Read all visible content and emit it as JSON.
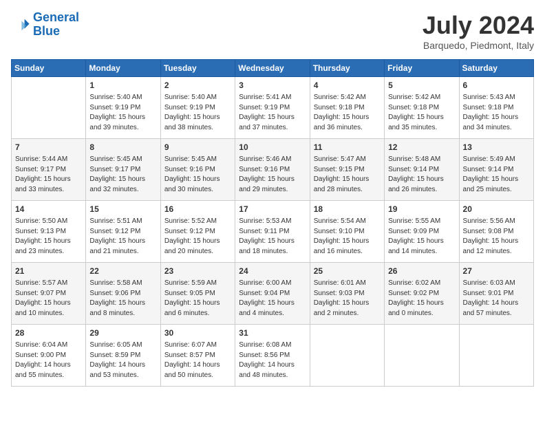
{
  "header": {
    "logo_line1": "General",
    "logo_line2": "Blue",
    "month": "July 2024",
    "location": "Barquedo, Piedmont, Italy"
  },
  "days_of_week": [
    "Sunday",
    "Monday",
    "Tuesday",
    "Wednesday",
    "Thursday",
    "Friday",
    "Saturday"
  ],
  "weeks": [
    [
      {
        "day": "",
        "content": ""
      },
      {
        "day": "1",
        "content": "Sunrise: 5:40 AM\nSunset: 9:19 PM\nDaylight: 15 hours\nand 39 minutes."
      },
      {
        "day": "2",
        "content": "Sunrise: 5:40 AM\nSunset: 9:19 PM\nDaylight: 15 hours\nand 38 minutes."
      },
      {
        "day": "3",
        "content": "Sunrise: 5:41 AM\nSunset: 9:19 PM\nDaylight: 15 hours\nand 37 minutes."
      },
      {
        "day": "4",
        "content": "Sunrise: 5:42 AM\nSunset: 9:18 PM\nDaylight: 15 hours\nand 36 minutes."
      },
      {
        "day": "5",
        "content": "Sunrise: 5:42 AM\nSunset: 9:18 PM\nDaylight: 15 hours\nand 35 minutes."
      },
      {
        "day": "6",
        "content": "Sunrise: 5:43 AM\nSunset: 9:18 PM\nDaylight: 15 hours\nand 34 minutes."
      }
    ],
    [
      {
        "day": "7",
        "content": "Sunrise: 5:44 AM\nSunset: 9:17 PM\nDaylight: 15 hours\nand 33 minutes."
      },
      {
        "day": "8",
        "content": "Sunrise: 5:45 AM\nSunset: 9:17 PM\nDaylight: 15 hours\nand 32 minutes."
      },
      {
        "day": "9",
        "content": "Sunrise: 5:45 AM\nSunset: 9:16 PM\nDaylight: 15 hours\nand 30 minutes."
      },
      {
        "day": "10",
        "content": "Sunrise: 5:46 AM\nSunset: 9:16 PM\nDaylight: 15 hours\nand 29 minutes."
      },
      {
        "day": "11",
        "content": "Sunrise: 5:47 AM\nSunset: 9:15 PM\nDaylight: 15 hours\nand 28 minutes."
      },
      {
        "day": "12",
        "content": "Sunrise: 5:48 AM\nSunset: 9:14 PM\nDaylight: 15 hours\nand 26 minutes."
      },
      {
        "day": "13",
        "content": "Sunrise: 5:49 AM\nSunset: 9:14 PM\nDaylight: 15 hours\nand 25 minutes."
      }
    ],
    [
      {
        "day": "14",
        "content": "Sunrise: 5:50 AM\nSunset: 9:13 PM\nDaylight: 15 hours\nand 23 minutes."
      },
      {
        "day": "15",
        "content": "Sunrise: 5:51 AM\nSunset: 9:12 PM\nDaylight: 15 hours\nand 21 minutes."
      },
      {
        "day": "16",
        "content": "Sunrise: 5:52 AM\nSunset: 9:12 PM\nDaylight: 15 hours\nand 20 minutes."
      },
      {
        "day": "17",
        "content": "Sunrise: 5:53 AM\nSunset: 9:11 PM\nDaylight: 15 hours\nand 18 minutes."
      },
      {
        "day": "18",
        "content": "Sunrise: 5:54 AM\nSunset: 9:10 PM\nDaylight: 15 hours\nand 16 minutes."
      },
      {
        "day": "19",
        "content": "Sunrise: 5:55 AM\nSunset: 9:09 PM\nDaylight: 15 hours\nand 14 minutes."
      },
      {
        "day": "20",
        "content": "Sunrise: 5:56 AM\nSunset: 9:08 PM\nDaylight: 15 hours\nand 12 minutes."
      }
    ],
    [
      {
        "day": "21",
        "content": "Sunrise: 5:57 AM\nSunset: 9:07 PM\nDaylight: 15 hours\nand 10 minutes."
      },
      {
        "day": "22",
        "content": "Sunrise: 5:58 AM\nSunset: 9:06 PM\nDaylight: 15 hours\nand 8 minutes."
      },
      {
        "day": "23",
        "content": "Sunrise: 5:59 AM\nSunset: 9:05 PM\nDaylight: 15 hours\nand 6 minutes."
      },
      {
        "day": "24",
        "content": "Sunrise: 6:00 AM\nSunset: 9:04 PM\nDaylight: 15 hours\nand 4 minutes."
      },
      {
        "day": "25",
        "content": "Sunrise: 6:01 AM\nSunset: 9:03 PM\nDaylight: 15 hours\nand 2 minutes."
      },
      {
        "day": "26",
        "content": "Sunrise: 6:02 AM\nSunset: 9:02 PM\nDaylight: 15 hours\nand 0 minutes."
      },
      {
        "day": "27",
        "content": "Sunrise: 6:03 AM\nSunset: 9:01 PM\nDaylight: 14 hours\nand 57 minutes."
      }
    ],
    [
      {
        "day": "28",
        "content": "Sunrise: 6:04 AM\nSunset: 9:00 PM\nDaylight: 14 hours\nand 55 minutes."
      },
      {
        "day": "29",
        "content": "Sunrise: 6:05 AM\nSunset: 8:59 PM\nDaylight: 14 hours\nand 53 minutes."
      },
      {
        "day": "30",
        "content": "Sunrise: 6:07 AM\nSunset: 8:57 PM\nDaylight: 14 hours\nand 50 minutes."
      },
      {
        "day": "31",
        "content": "Sunrise: 6:08 AM\nSunset: 8:56 PM\nDaylight: 14 hours\nand 48 minutes."
      },
      {
        "day": "",
        "content": ""
      },
      {
        "day": "",
        "content": ""
      },
      {
        "day": "",
        "content": ""
      }
    ]
  ]
}
